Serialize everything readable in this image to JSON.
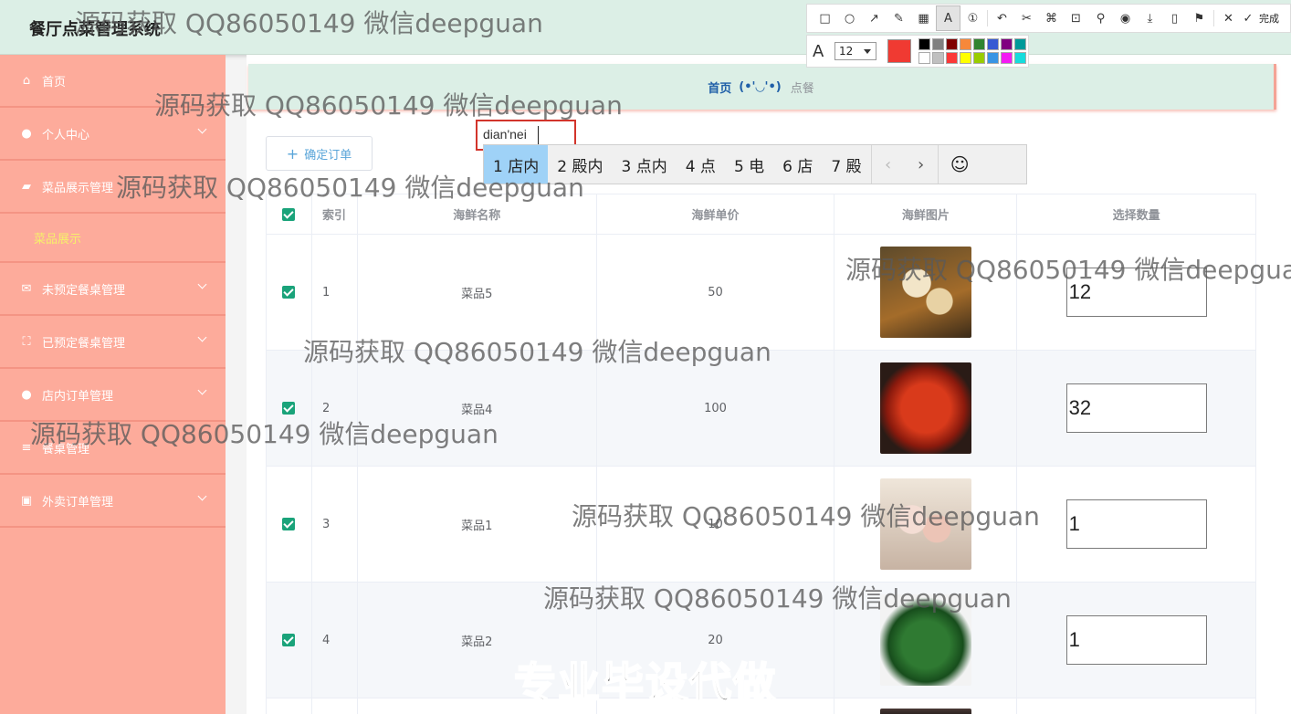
{
  "header": {
    "title": "餐厅点菜管理系统"
  },
  "sidebar": {
    "items": [
      {
        "label": "首页",
        "icon": "home-icon",
        "glyph": "⌂",
        "expandable": false
      },
      {
        "label": "个人中心",
        "icon": "user-icon",
        "glyph": "●",
        "expandable": true
      },
      {
        "label": "菜品展示管理",
        "icon": "briefcase-icon",
        "glyph": "▰",
        "expandable": false
      },
      {
        "label": "菜品展示",
        "icon": "",
        "glyph": "",
        "sub": true
      },
      {
        "label": "未预定餐桌管理",
        "icon": "mail-icon",
        "glyph": "✉",
        "expandable": true
      },
      {
        "label": "已预定餐桌管理",
        "icon": "scan-icon",
        "glyph": "⛶",
        "expandable": true
      },
      {
        "label": "店内订单管理",
        "icon": "user-icon",
        "glyph": "●",
        "expandable": true
      },
      {
        "label": "餐桌管理",
        "icon": "list-icon",
        "glyph": "≡",
        "expandable": false
      },
      {
        "label": "外卖订单管理",
        "icon": "clipboard-icon",
        "glyph": "▣",
        "expandable": true
      }
    ]
  },
  "breadcrumb": {
    "home": "首页",
    "face": "(•'◡'•)",
    "current": "点餐"
  },
  "toolbar": {
    "confirm_label": "确定订单",
    "confirm_glyph": "+"
  },
  "table": {
    "columns": [
      "索引",
      "海鲜名称",
      "海鲜单价",
      "海鲜图片",
      "选择数量"
    ],
    "rows": [
      {
        "index": "1",
        "name": "菜品5",
        "price": "50",
        "qty": "12",
        "image": "f1"
      },
      {
        "index": "2",
        "name": "菜品4",
        "price": "100",
        "qty": "32",
        "image": "f2"
      },
      {
        "index": "3",
        "name": "菜品1",
        "price": "10",
        "qty": "1",
        "image": "f3"
      },
      {
        "index": "4",
        "name": "菜品2",
        "price": "20",
        "qty": "1",
        "image": "f4"
      }
    ]
  },
  "ime": {
    "composition": "dian'nei",
    "candidates": [
      "1 店内",
      "2 殿内",
      "3 点内",
      "4 点",
      "5 电",
      "6 店",
      "7 殿"
    ],
    "prev_glyph": "‹",
    "next_glyph": "›",
    "emoji_glyph": "☺"
  },
  "annotation": {
    "done_label": "完成",
    "font_size": "12",
    "font_glyph": "A",
    "current_color": "#f03a32",
    "palette": [
      "#000000",
      "#808080",
      "#800000",
      "#f7883a",
      "#308430",
      "#385ad3",
      "#800080",
      "#009999",
      "#ffffff",
      "#c0c0c0",
      "#fb3838",
      "#ffff00",
      "#99cc00",
      "#3894e4",
      "#f31bf3",
      "#16dcdc"
    ]
  },
  "watermarks": {
    "text": "源码获取 QQ86050149 微信deepguan",
    "big": "专业毕设代做"
  }
}
